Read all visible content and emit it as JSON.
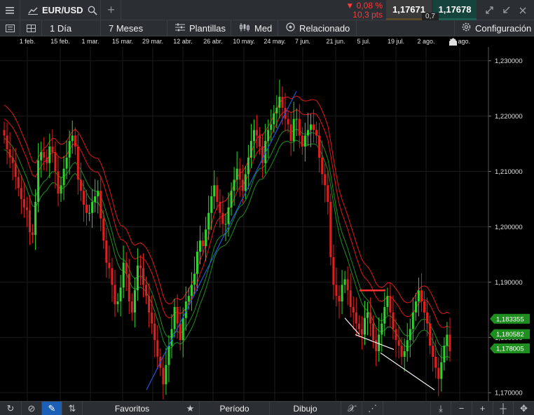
{
  "top": {
    "symbol": "EUR/USD",
    "change_percent": "▼ 0,08 %",
    "change_pts": "10,3 pts",
    "bid": "1,17671",
    "ask": "1,17678",
    "spread": "0,7",
    "icons": [
      "menu-icon",
      "chart-line-icon",
      "search-icon",
      "plus-icon",
      "expand-icon",
      "external-link-icon",
      "close-icon"
    ]
  },
  "toolbar": {
    "interval": "1 Día",
    "range": "7 Meses",
    "templates": "Plantillas",
    "chart_type": "Med",
    "related": "Relacionado",
    "settings": "Configuración"
  },
  "bottom": {
    "favorites": "Favoritos",
    "period": "Período",
    "drawing": "Dibujo"
  },
  "chart_data": {
    "type": "candlestick",
    "x_ticks": [
      "1 feb.",
      "15 feb.",
      "1 mar.",
      "15 mar.",
      "29 mar.",
      "12 abr.",
      "26 abr.",
      "10 may.",
      "24 may.",
      "7 jun.",
      "21 jun.",
      "5 jul.",
      "19 jul.",
      "2 ago.",
      "16 ago."
    ],
    "y_ticks": [
      "1,230000",
      "1,220000",
      "1,210000",
      "1,200000",
      "1,190000",
      "1,180000",
      "1,170000"
    ],
    "ylim": [
      1.1685,
      1.2325
    ],
    "price_labels": [
      {
        "text": "1,183355",
        "value": 1.183355
      },
      {
        "text": "1,180582",
        "value": 1.180582
      },
      {
        "text": "1,178005",
        "value": 1.178005
      }
    ],
    "close_series": [
      1.2165,
      1.214,
      1.2125,
      1.2115,
      1.209,
      1.207,
      1.205,
      1.2035,
      1.203,
      1.199,
      1.1985,
      1.2045,
      1.212,
      1.2135,
      1.2125,
      1.2115,
      1.2145,
      1.2135,
      1.21,
      1.206,
      1.2075,
      1.2105,
      1.2125,
      1.2155,
      1.2165,
      1.2145,
      1.2085,
      1.2065,
      1.204,
      1.2025,
      1.2025,
      1.2045,
      1.2055,
      1.2065,
      1.2015,
      1.1975,
      1.1935,
      1.1925,
      1.1895,
      1.186,
      1.1865,
      1.189,
      1.1935,
      1.1915,
      1.1865,
      1.1845,
      1.1885,
      1.193,
      1.1925,
      1.1895,
      1.1875,
      1.1845,
      1.1825,
      1.1795,
      1.1765,
      1.1745,
      1.1715,
      1.175,
      1.1785,
      1.1815,
      1.1855,
      1.1825,
      1.1795,
      1.1835,
      1.1865,
      1.1875,
      1.1895,
      1.1915,
      1.1955,
      1.1975,
      1.1965,
      1.1995,
      1.2025,
      1.2055,
      1.2075,
      1.2045,
      1.2025,
      1.2005,
      1.2005,
      1.2035,
      1.2065,
      1.2085,
      1.2105,
      1.2085,
      1.2065,
      1.2095,
      1.2125,
      1.2155,
      1.2175,
      1.2165,
      1.2145,
      1.2115,
      1.2155,
      1.2175,
      1.2185,
      1.2205,
      1.2215,
      1.2235,
      1.2215,
      1.2195,
      1.2185,
      1.2155,
      1.2195,
      1.2195,
      1.2165,
      1.2145,
      1.2165,
      1.2175,
      1.2185,
      1.2175,
      1.2165,
      1.2125,
      1.2095,
      1.2075,
      1.2045,
      1.1945,
      1.1895,
      1.1875,
      1.1865,
      1.1895,
      1.1905,
      1.1885,
      1.1855,
      1.1845,
      1.1825,
      1.1815,
      1.1805,
      1.1835,
      1.1845,
      1.1825,
      1.1795,
      1.1775,
      1.1805,
      1.1825,
      1.1855,
      1.1875,
      1.1845,
      1.1815,
      1.1795,
      1.1785,
      1.1765,
      1.1775,
      1.1795,
      1.1815,
      1.1845,
      1.1865,
      1.1885,
      1.1865,
      1.1845,
      1.1825,
      1.1785,
      1.1765,
      1.1745,
      1.1725,
      1.1755,
      1.1785,
      1.1805,
      1.1775
    ],
    "drawings": {
      "trend_up": {
        "from": {
          "x": "29 mar.",
          "y": 1.1705
        },
        "to": {
          "x": "1 jun.",
          "y": 1.2245
        }
      },
      "resistance": {
        "value": 1.1885
      },
      "support_lines": [
        {
          "from": {
            "x": "2 jul.",
            "y": 1.1805
          },
          "to": {
            "x": "10 jul.",
            "y": 1.1775
          }
        },
        {
          "from": {
            "x": "10 jul.",
            "y": 1.1765
          },
          "to": {
            "x": "31 jul.",
            "y": 1.1705
          }
        }
      ]
    },
    "colors": {
      "up": "#2fd42f",
      "down": "#e02020",
      "envelope_red": "#e01818",
      "envelope_green": "#1e8f1e",
      "trendline": "#2255dd",
      "grid": "#1b1b1b",
      "price_label_bg": "#1e8f1e"
    },
    "grid": true
  }
}
